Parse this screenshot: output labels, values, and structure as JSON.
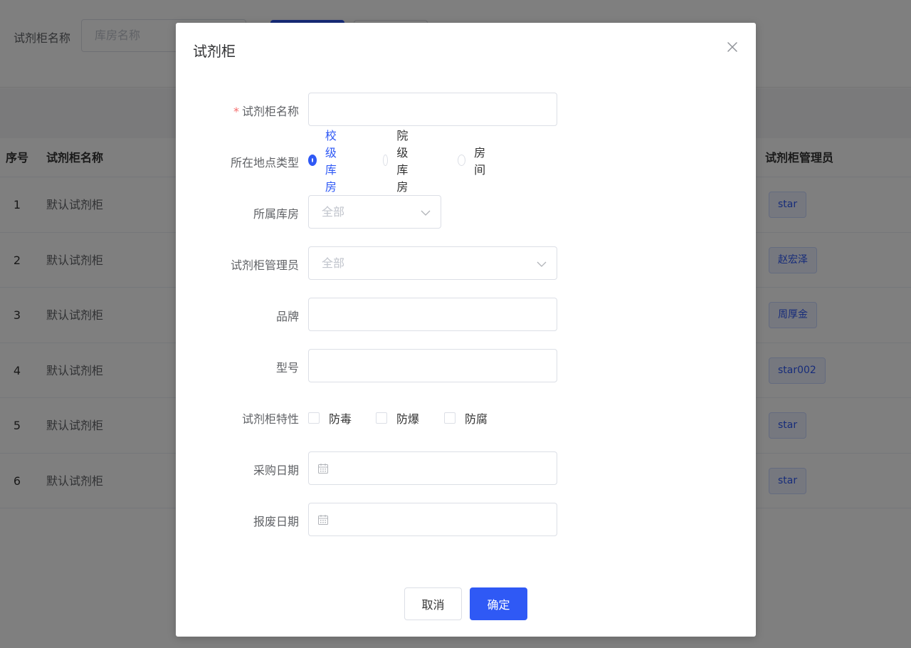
{
  "filter": {
    "label": "试剂柜名称",
    "placeholder": "库房名称"
  },
  "table": {
    "headers": {
      "index": "序号",
      "name": "试剂柜名称",
      "manager": "试剂柜管理员"
    },
    "rows": [
      {
        "index": "1",
        "name": "默认试剂柜",
        "manager": "star"
      },
      {
        "index": "2",
        "name": "默认试剂柜",
        "manager": "赵宏泽"
      },
      {
        "index": "3",
        "name": "默认试剂柜",
        "manager": "周厚金"
      },
      {
        "index": "4",
        "name": "默认试剂柜",
        "manager": "star002"
      },
      {
        "index": "5",
        "name": "默认试剂柜",
        "manager": "star"
      },
      {
        "index": "6",
        "name": "默认试剂柜",
        "manager": "star"
      }
    ]
  },
  "dialog": {
    "title": "试剂柜",
    "fields": {
      "name_label": "试剂柜名称",
      "name_required": "*",
      "location_type_label": "所在地点类型",
      "location_options": [
        "校级库房",
        "院级库房",
        "房间"
      ],
      "location_selected": "校级库房",
      "warehouse_label": "所属库房",
      "warehouse_value": "全部",
      "manager_label": "试剂柜管理员",
      "manager_value": "全部",
      "brand_label": "品牌",
      "model_label": "型号",
      "features_label": "试剂柜特性",
      "feature_options": [
        "防毒",
        "防爆",
        "防腐"
      ],
      "purchase_date_label": "采购日期",
      "scrap_date_label": "报废日期"
    },
    "cancel_label": "取消",
    "ok_label": "确定"
  },
  "colors": {
    "primary": "#2f59f5",
    "required": "#f56c6c",
    "overlay": "rgba(0,0,0,0.5)"
  }
}
